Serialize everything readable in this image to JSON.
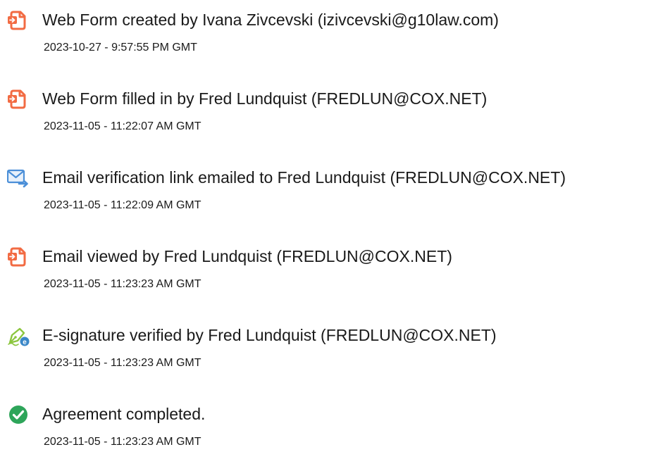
{
  "colors": {
    "document_icon": "#f26b43",
    "email_icon": "#4b8fd8",
    "signature_icon": "#8cc63f",
    "complete_icon": "#2ea55a",
    "text": "#1a1a1a"
  },
  "events": [
    {
      "icon": "form-document-icon",
      "text": "Web Form created by Ivana Zivcevski (izivcevski@g10law.com)",
      "timestamp": "2023-10-27 - 9:57:55 PM GMT"
    },
    {
      "icon": "form-document-icon",
      "text": "Web Form filled in by Fred Lundquist (FREDLUN@COX.NET)",
      "timestamp": "2023-11-05 - 11:22:07 AM GMT"
    },
    {
      "icon": "email-send-icon",
      "text": "Email verification link emailed to Fred Lundquist (FREDLUN@COX.NET)",
      "timestamp": "2023-11-05 - 11:22:09 AM GMT"
    },
    {
      "icon": "form-document-icon",
      "text": "Email viewed by Fred Lundquist (FREDLUN@COX.NET)",
      "timestamp": "2023-11-05 - 11:23:23 AM GMT"
    },
    {
      "icon": "e-signature-pen-icon",
      "text": "E-signature verified by Fred Lundquist (FREDLUN@COX.NET)",
      "timestamp": "2023-11-05 - 11:23:23 AM GMT"
    },
    {
      "icon": "checkmark-circle-icon",
      "text": "Agreement completed.",
      "timestamp": "2023-11-05 - 11:23:23 AM GMT"
    }
  ]
}
